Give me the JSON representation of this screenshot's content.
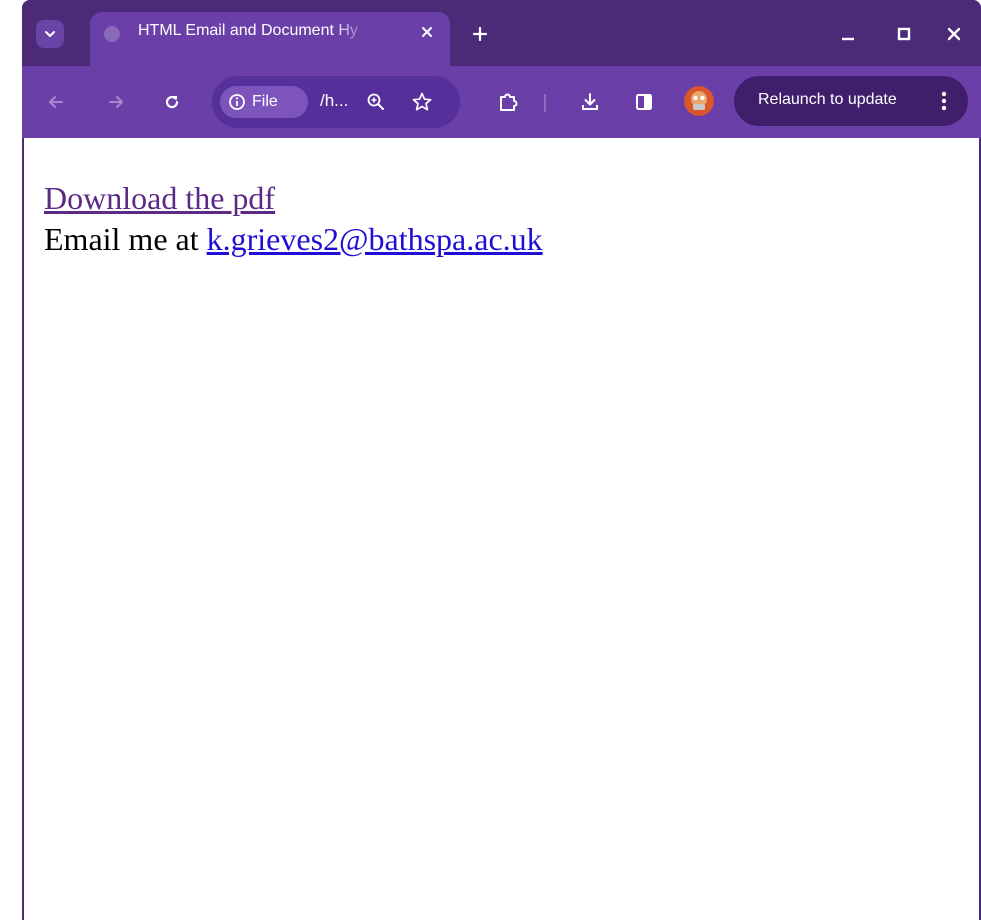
{
  "tab": {
    "title": "HTML Email and Document Hy"
  },
  "toolbar": {
    "file_chip": "File",
    "url_text": "/h...",
    "relaunch_label": "Relaunch to update"
  },
  "page": {
    "link_download": "Download the pdf",
    "email_prefix": "Email me at ",
    "email_link": "k.grieves2@bathspa.ac.uk"
  },
  "colors": {
    "frame": "#4b2a78",
    "toolbar": "#6b3fa8",
    "visited_link": "#5c2a86",
    "link": "#1f0fd6"
  },
  "icons": [
    "tab-search-icon",
    "globe-icon",
    "close-icon",
    "plus-icon",
    "minimize-icon",
    "maximize-icon",
    "close-window-icon",
    "back-icon",
    "forward-icon",
    "reload-icon",
    "info-icon",
    "zoom-icon",
    "star-icon",
    "extensions-icon",
    "download-icon",
    "side-panel-icon",
    "avatar",
    "kebab-menu-icon"
  ]
}
